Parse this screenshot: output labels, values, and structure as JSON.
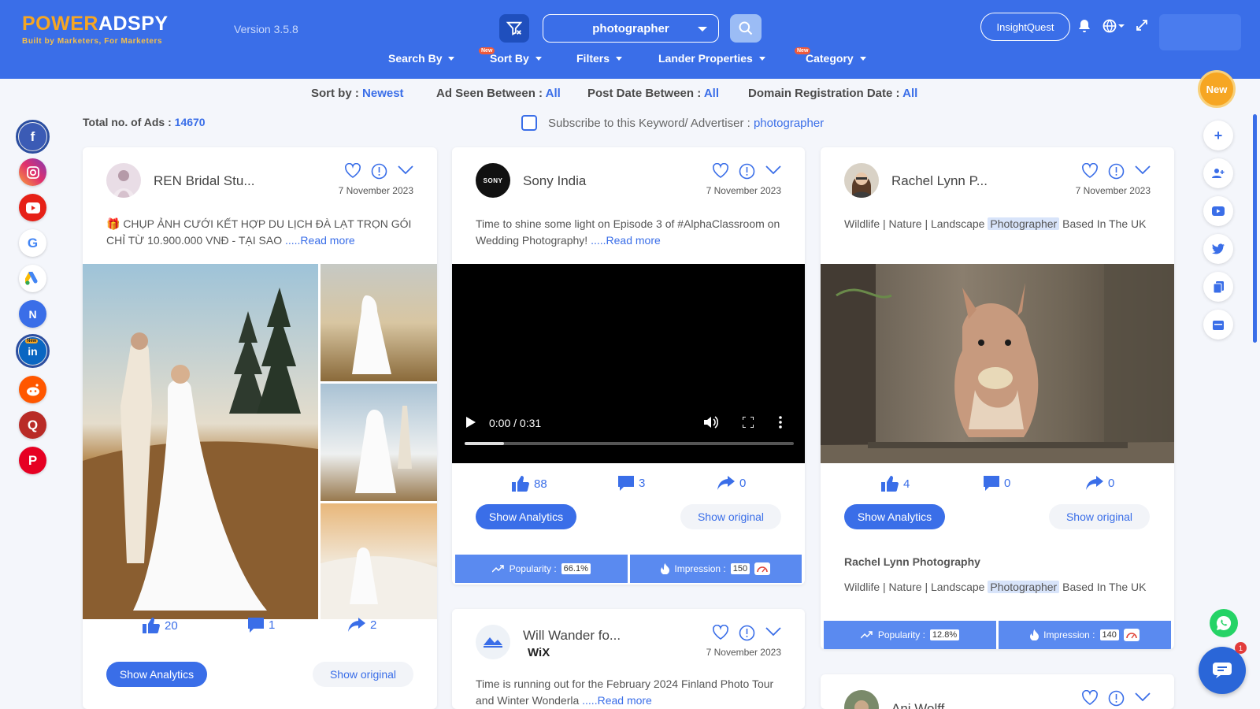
{
  "header": {
    "logo_part1": "POWER",
    "logo_part2": "ADSPY",
    "logo_tagline": "Built by Marketers, For Marketers",
    "version": "Version 3.5.8",
    "search_value": "photographer",
    "insight_button": "InsightQuest",
    "nav": [
      {
        "label": "Search By",
        "new": ""
      },
      {
        "label": "Sort By",
        "new": "New"
      },
      {
        "label": "Filters",
        "new": ""
      },
      {
        "label": "Lander Properties",
        "new": ""
      },
      {
        "label": "Category",
        "new": "New"
      }
    ]
  },
  "sortbar": {
    "sort_label": "Sort by :",
    "sort_value": "Newest",
    "seen_label": "Ad Seen Between :",
    "seen_value": "All",
    "post_label": "Post Date Between :",
    "post_value": "All",
    "domain_label": "Domain Registration Date :",
    "domain_value": "All"
  },
  "summary": {
    "total_label": "Total no. of Ads :",
    "total_value": "14670",
    "subscribe_label": "Subscribe to this Keyword/ Advertiser :",
    "subscribe_value": "photographer"
  },
  "social_platforms": [
    "facebook-icon",
    "instagram-icon",
    "youtube-icon",
    "google-icon",
    "google-ads-icon",
    "native-icon",
    "linkedin-icon",
    "reddit-icon",
    "quora-icon",
    "pinterest-icon"
  ],
  "linkedin_new": "New",
  "right_rail": {
    "new_badge": "New",
    "chat_count": "1"
  },
  "cards": {
    "ren": {
      "advertiser": "REN Bridal Stu...",
      "date": "7 November 2023",
      "text": "🎁 CHỤP ẢNH CƯỚI KẾT HỢP DU LỊCH ĐÀ LẠT TRỌN GÓI CHỈ TỪ 10.900.000 VNĐ - TẠI SAO",
      "more": ".....Read more",
      "likes": "20",
      "comments": "1",
      "shares": "2",
      "analytics_button": "Show Analytics",
      "original_button": "Show original"
    },
    "sony": {
      "advertiser": "Sony India",
      "avatar_text": "SONY",
      "date": "7 November 2023",
      "text": "Time to shine some light on Episode 3 of #AlphaClassroom on Wedding Photography!",
      "more": ".....Read more",
      "video_time": "0:00 / 0:31",
      "likes": "88",
      "comments": "3",
      "shares": "0",
      "analytics_button": "Show Analytics",
      "original_button": "Show original",
      "popularity_label": "Popularity :",
      "popularity_value": "66.1%",
      "impression_label": "Impression :",
      "impression_value": "150"
    },
    "rachel": {
      "advertiser": "Rachel Lynn P...",
      "date": "7 November 2023",
      "text_before": "Wildlife | Nature | Landscape",
      "text_highlight": "Photographer",
      "text_after": "Based In The UK",
      "likes": "4",
      "comments": "0",
      "shares": "0",
      "analytics_button": "Show Analytics",
      "original_button": "Show original",
      "page_name": "Rachel Lynn Photography",
      "sub_before": "Wildlife | Nature | Landscape",
      "sub_highlight": "Photographer",
      "sub_after": "Based In The UK",
      "popularity_label": "Popularity :",
      "popularity_value": "12.8%",
      "impression_label": "Impression :",
      "impression_value": "140"
    },
    "will": {
      "advertiser": "Will Wander fo...",
      "sub_brand": "WiX",
      "date": "7 November 2023",
      "text": "Time is running out for the February 2024 Finland Photo Tour and Winter Wonderla",
      "more": ".....Read more"
    },
    "ani": {
      "advertiser": "Ani Wolff"
    }
  },
  "colors": {
    "brand": "#3a6ee8",
    "logo_orange": "#f6a623",
    "metric_bar": "#5a8af0"
  }
}
